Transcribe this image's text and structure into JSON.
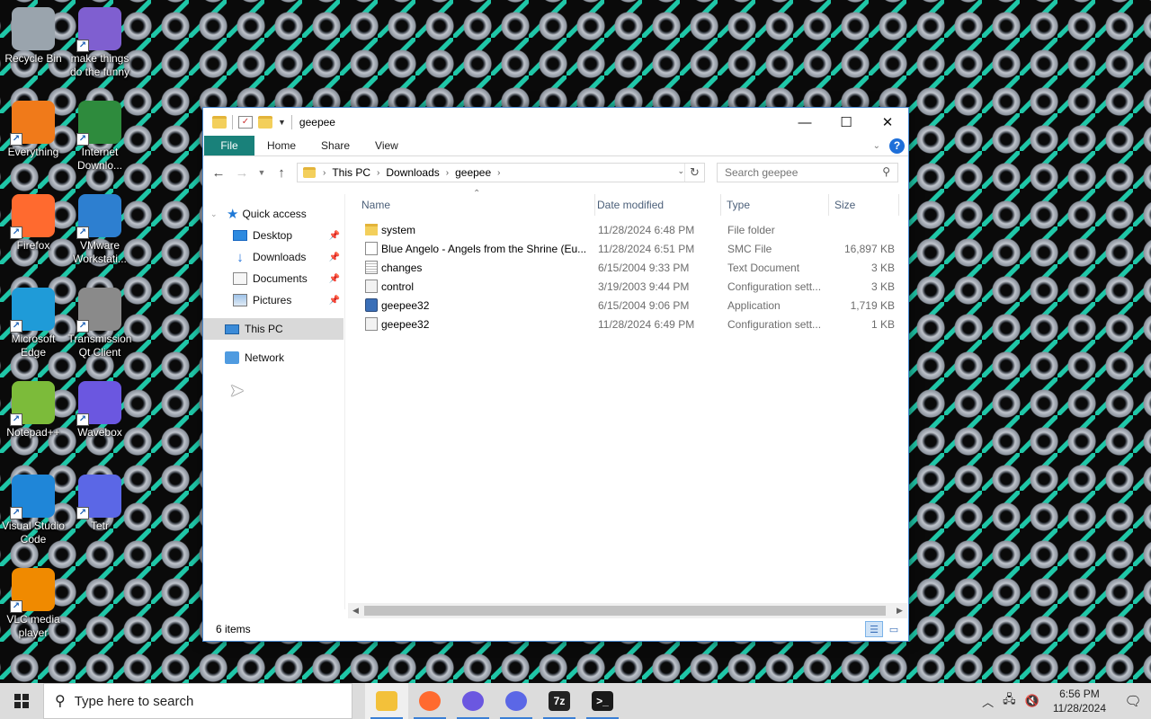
{
  "desktop": {
    "icons": [
      {
        "label": "Recycle Bin",
        "icon": "recycle-bin-icon",
        "color": "#9aa4ad"
      },
      {
        "label": "make things do the funny",
        "icon": "shortcut-icon",
        "color": "#7f5fd0"
      },
      {
        "label": "Everything",
        "icon": "search-app-icon",
        "color": "#f07a1a"
      },
      {
        "label": "Internet Downlo...",
        "icon": "globe-icon",
        "color": "#2e8b3d"
      },
      {
        "label": "Firefox",
        "icon": "firefox-icon",
        "color": "#ff6a2f"
      },
      {
        "label": "VMware Workstati...",
        "icon": "vmware-icon",
        "color": "#2d7fd0"
      },
      {
        "label": "Microsoft Edge",
        "icon": "edge-icon",
        "color": "#1f9bd8"
      },
      {
        "label": "Transmission Qt Client",
        "icon": "transmission-icon",
        "color": "#8a8a8a"
      },
      {
        "label": "Notepad++",
        "icon": "notepad-icon",
        "color": "#7cbb3a"
      },
      {
        "label": "Wavebox",
        "icon": "wavebox-icon",
        "color": "#6b57e0"
      },
      {
        "label": "Visual Studio Code",
        "icon": "vscode-icon",
        "color": "#1f86d8"
      },
      {
        "label": "Tetr",
        "icon": "tetr-icon",
        "color": "#5b67e6"
      },
      {
        "label": "VLC media player",
        "icon": "vlc-icon",
        "color": "#f08a00"
      }
    ]
  },
  "window": {
    "title": "geepee",
    "ribbon_tabs": [
      "File",
      "Home",
      "Share",
      "View"
    ],
    "breadcrumb": [
      "This PC",
      "Downloads",
      "geepee"
    ],
    "search_placeholder": "Search geepee"
  },
  "navpane": {
    "quick_access": "Quick access",
    "pinned": [
      "Desktop",
      "Downloads",
      "Documents",
      "Pictures"
    ],
    "this_pc": "This PC",
    "network": "Network"
  },
  "columns": [
    "Name",
    "Date modified",
    "Type",
    "Size"
  ],
  "files": [
    {
      "name": "system",
      "date": "11/28/2024 6:48 PM",
      "type": "File folder",
      "size": "",
      "icon": "folder"
    },
    {
      "name": "Blue Angelo - Angels from the Shrine (Eu...",
      "date": "11/28/2024 6:51 PM",
      "type": "SMC File",
      "size": "16,897 KB",
      "icon": "file"
    },
    {
      "name": "changes",
      "date": "6/15/2004 9:33 PM",
      "type": "Text Document",
      "size": "3 KB",
      "icon": "text"
    },
    {
      "name": "control",
      "date": "3/19/2003 9:44 PM",
      "type": "Configuration sett...",
      "size": "3 KB",
      "icon": "cfg"
    },
    {
      "name": "geepee32",
      "date": "6/15/2004 9:06 PM",
      "type": "Application",
      "size": "1,719 KB",
      "icon": "app"
    },
    {
      "name": "geepee32",
      "date": "11/28/2024 6:49 PM",
      "type": "Configuration sett...",
      "size": "1 KB",
      "icon": "cfg"
    }
  ],
  "status": {
    "items": "6 items"
  },
  "taskbar": {
    "search_placeholder": "Type here to search",
    "apps": [
      {
        "name": "file-explorer",
        "color": "#f3c13a",
        "glyph": ""
      },
      {
        "name": "firefox",
        "color": "#ff6a2f",
        "glyph": ""
      },
      {
        "name": "wavebox",
        "color": "#6b57e0",
        "glyph": ""
      },
      {
        "name": "tetr",
        "color": "#5b67e6",
        "glyph": ""
      },
      {
        "name": "7zip",
        "color": "#222222",
        "glyph": "7z"
      },
      {
        "name": "terminal",
        "color": "#1a1a1a",
        "glyph": ">_"
      }
    ],
    "time": "6:56 PM",
    "date": "11/28/2024"
  },
  "colors": {
    "accent": "#19817a",
    "selection": "#d9d9d9",
    "link_blue": "#1e6fd9"
  }
}
